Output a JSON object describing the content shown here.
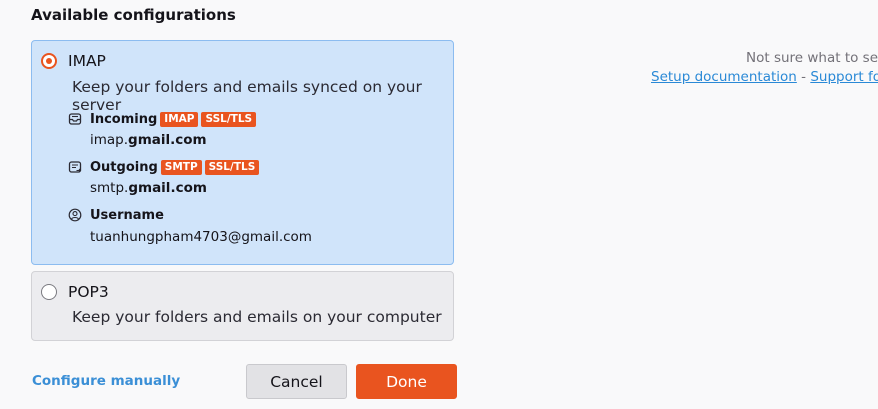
{
  "section_title": "Available configurations",
  "configs": [
    {
      "name": "IMAP",
      "description": "Keep your folders and emails synced on your server",
      "selected": true,
      "incoming": {
        "label": "Incoming",
        "badges": [
          "IMAP",
          "SSL/TLS"
        ],
        "host_prefix": "imap.",
        "host_domain": "gmail.com"
      },
      "outgoing": {
        "label": "Outgoing",
        "badges": [
          "SMTP",
          "SSL/TLS"
        ],
        "host_prefix": "smtp.",
        "host_domain": "gmail.com"
      },
      "username": {
        "label": "Username",
        "value": "tuanhungpham4703@gmail.com"
      }
    },
    {
      "name": "POP3",
      "description": "Keep your folders and emails on your computer",
      "selected": false
    }
  ],
  "actions": {
    "configure_manually": "Configure manually",
    "cancel": "Cancel",
    "done": "Done"
  },
  "help": {
    "text": "Not sure what to sel",
    "setup_doc": "Setup documentation",
    "separator": " - ",
    "support": "Support for"
  },
  "colors": {
    "accent": "#e9541f",
    "selected_bg": "#d0e4fa",
    "link": "#2a89d6"
  }
}
